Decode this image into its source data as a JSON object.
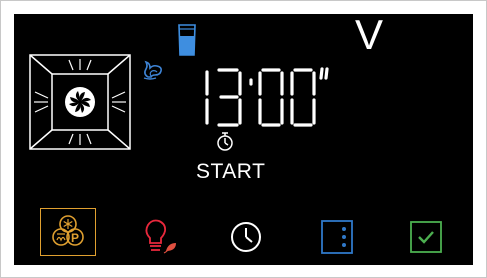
{
  "panel": {
    "level_letter": "V",
    "time_display": "13:00\"",
    "start_label": "START"
  },
  "icons": {
    "oven_fan": "fan-mode-icon",
    "steam": "steam-icon",
    "water_tank": "water-tank-icon",
    "stopwatch": "stopwatch-icon",
    "programs": "programs-icon",
    "light": "oven-light-icon",
    "clock": "clock-icon",
    "menu": "menu-icon",
    "confirm": "confirm-icon"
  },
  "colors": {
    "background": "#000000",
    "programs_accent": "#e0a030",
    "light_accent": "#e8283c",
    "leaf_accent": "#e05040",
    "menu_accent": "#2f78c8",
    "confirm_accent": "#4caf50",
    "steam_accent": "#3e84d6",
    "tank_accent": "#3e8ee0"
  }
}
